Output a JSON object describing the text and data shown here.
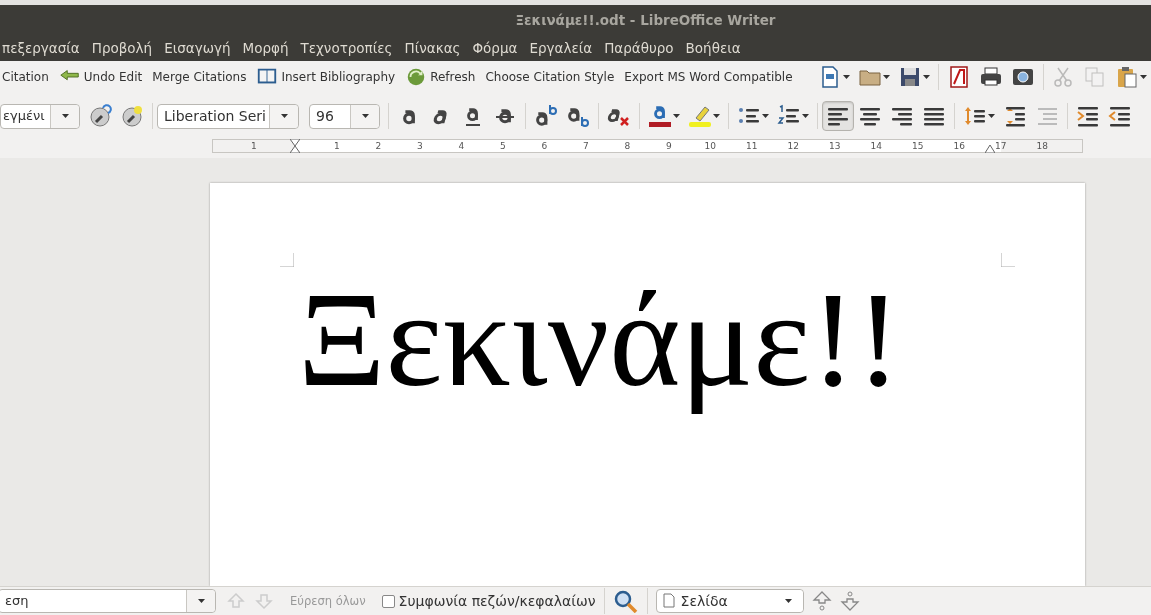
{
  "window": {
    "title": "Ξεκινάμε!!.odt - LibreOffice Writer"
  },
  "menu": [
    "πεξεργασία",
    "Προβολή",
    "Εισαγωγή",
    "Μορφή",
    "Τεχνοτροπίες",
    "Πίνακας",
    "Φόρμα",
    "Εργαλεία",
    "Παράθυρο",
    "Βοήθεια"
  ],
  "citation_toolbar": [
    {
      "kind": "text",
      "label": "Citation"
    },
    {
      "kind": "undo",
      "label": "Undo Edit"
    },
    {
      "kind": "text",
      "label": "Merge Citations"
    },
    {
      "kind": "book",
      "label": "Insert Bibliography"
    },
    {
      "kind": "refresh",
      "label": "Refresh"
    },
    {
      "kind": "text",
      "label": "Choose Citation Style"
    },
    {
      "kind": "text",
      "label": "Export MS Word Compatible"
    }
  ],
  "standard_toolbar": [
    {
      "kind": "new",
      "disabled": false,
      "dropdown": true
    },
    {
      "kind": "open",
      "disabled": false,
      "dropdown": true
    },
    {
      "kind": "save",
      "disabled": false,
      "dropdown": true
    },
    {
      "kind": "pdf",
      "disabled": false,
      "dropdown": false
    },
    {
      "kind": "print",
      "disabled": false,
      "dropdown": false
    },
    {
      "kind": "preview",
      "disabled": false,
      "dropdown": false
    },
    {
      "kind": "cut",
      "disabled": true,
      "dropdown": false
    },
    {
      "kind": "copy",
      "disabled": true,
      "dropdown": false
    },
    {
      "kind": "paste",
      "disabled": false,
      "dropdown": true
    }
  ],
  "formatting_toolbar": {
    "style": "εγμένι",
    "font": "Liberation Seri",
    "size": "96",
    "buttons": [
      {
        "kind": "bold",
        "selected": false,
        "dropdown": false
      },
      {
        "kind": "italic",
        "selected": false,
        "dropdown": false
      },
      {
        "kind": "underline",
        "selected": false,
        "dropdown": false
      },
      {
        "kind": "strike",
        "selected": false,
        "dropdown": false
      },
      {
        "kind": "superscript",
        "selected": false,
        "dropdown": false
      },
      {
        "kind": "subscript",
        "selected": false,
        "dropdown": false
      },
      {
        "kind": "clear",
        "selected": false,
        "dropdown": false
      },
      {
        "kind": "fontcolor",
        "selected": false,
        "dropdown": true
      },
      {
        "kind": "highlight",
        "selected": false,
        "dropdown": true
      },
      {
        "kind": "bullets",
        "selected": false,
        "dropdown": true
      },
      {
        "kind": "numbering",
        "selected": false,
        "dropdown": true
      },
      {
        "kind": "left",
        "selected": true,
        "dropdown": false
      },
      {
        "kind": "center",
        "selected": false,
        "dropdown": false
      },
      {
        "kind": "right",
        "selected": false,
        "dropdown": false
      },
      {
        "kind": "justify",
        "selected": false,
        "dropdown": false
      },
      {
        "kind": "spacing",
        "selected": false,
        "dropdown": true
      },
      {
        "kind": "paraspace",
        "selected": false,
        "dropdown": false
      },
      {
        "kind": "paraspace_off",
        "selected": false,
        "dropdown": false
      },
      {
        "kind": "indent",
        "selected": false,
        "dropdown": false
      },
      {
        "kind": "outdent",
        "selected": false,
        "dropdown": false
      }
    ]
  },
  "ruler": {
    "labels": [
      "1",
      "1",
      "2",
      "3",
      "4",
      "5",
      "6",
      "7",
      "8",
      "9",
      "10",
      "11",
      "12",
      "13",
      "14",
      "15",
      "16",
      "17",
      "18"
    ]
  },
  "document": {
    "text": "Ξεκινάμε!!"
  },
  "find_bar": {
    "search_value": "εση",
    "find_all": "Εύρεση όλων",
    "match_case": {
      "label": "Συμφωνία πεζών/κεφαλαίων",
      "checked": false
    },
    "search_by": "Σελίδα"
  }
}
